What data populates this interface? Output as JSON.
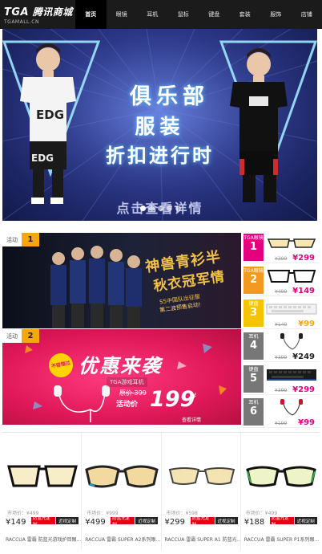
{
  "header": {
    "logo_main": "TGA",
    "logo_cn": "腾讯商城",
    "logo_sub": "TGAMALL.CN",
    "nav": [
      {
        "label": "首页",
        "active": true
      },
      {
        "label": "眼镜",
        "active": false
      },
      {
        "label": "耳机",
        "active": false
      },
      {
        "label": "鼠标",
        "active": false
      },
      {
        "label": "键盘",
        "active": false
      },
      {
        "label": "套装",
        "active": false
      },
      {
        "label": "服饰",
        "active": false
      },
      {
        "label": "店铺",
        "active": false
      }
    ]
  },
  "banner": {
    "line1": "俱乐部",
    "line2": "服装",
    "line3": "折扣进行时",
    "cta": "点击查看详情",
    "dots": 5,
    "active_dot": 0
  },
  "promo1": {
    "tag_label": "活动",
    "tag_num": "1",
    "headline1": "神兽青衫半",
    "headline2": "秋衣冠军情",
    "sub1": "S5中国队出征服",
    "sub2": "第二波预售启动!"
  },
  "promo2": {
    "tag_label": "活动",
    "tag_num": "2",
    "badge": "不容错过",
    "title": "优惠来袭",
    "sub": "TGA游戏耳机",
    "old_price": "原价 399",
    "act_label": "活动价",
    "price": "199",
    "currency": "¥",
    "link": "查看详情"
  },
  "right_items": [
    {
      "label": "TGA眼镜",
      "num": "1",
      "color": "#e4007f",
      "old": "¥399",
      "price": "¥299",
      "icon": "glasses-icon"
    },
    {
      "label": "TGA眼镜",
      "num": "2",
      "color": "#f29a1f",
      "old": "¥499",
      "price": "¥149",
      "icon": "glasses-icon"
    },
    {
      "label": "键盘",
      "num": "3",
      "color": "#f5c400",
      "old": "¥149",
      "price": "¥99",
      "icon": "keyboard-icon"
    },
    {
      "label": "耳机",
      "num": "4",
      "color": "#777777",
      "old": "¥399",
      "price": "¥249",
      "icon": "earphone-icon"
    },
    {
      "label": "键盘",
      "num": "5",
      "color": "#777777",
      "old": "¥399",
      "price": "¥299",
      "icon": "keyboard-icon"
    },
    {
      "label": "耳机",
      "num": "6",
      "color": "#777777",
      "old": "¥199",
      "price": "¥99",
      "icon": "earphone-icon"
    }
  ],
  "products": [
    {
      "old": "市场价：¥499",
      "price": "¥149",
      "btn_red": "防蓝光定制",
      "btn_black": "近视定制",
      "name": "RACCUA 雷霸 防蓝光游戏护目眼..."
    },
    {
      "old": "市场价：¥999",
      "price": "¥499",
      "btn_red": "防蓝光定制",
      "btn_black": "近视定制",
      "name": "RACCUA 雷霸 SUPER A2系列眼..."
    },
    {
      "old": "市场价：¥598",
      "price": "¥299",
      "btn_red": "防蓝光定制",
      "btn_black": "近视定制",
      "name": "RACCUA 雷霸 SUPER A1 防蓝光..."
    },
    {
      "old": "市场价：¥499",
      "price": "¥188",
      "btn_red": "防蓝光定制",
      "btn_black": "近视定制",
      "name": "RACCUA 雷霸 SUPER P1系列眼..."
    }
  ]
}
